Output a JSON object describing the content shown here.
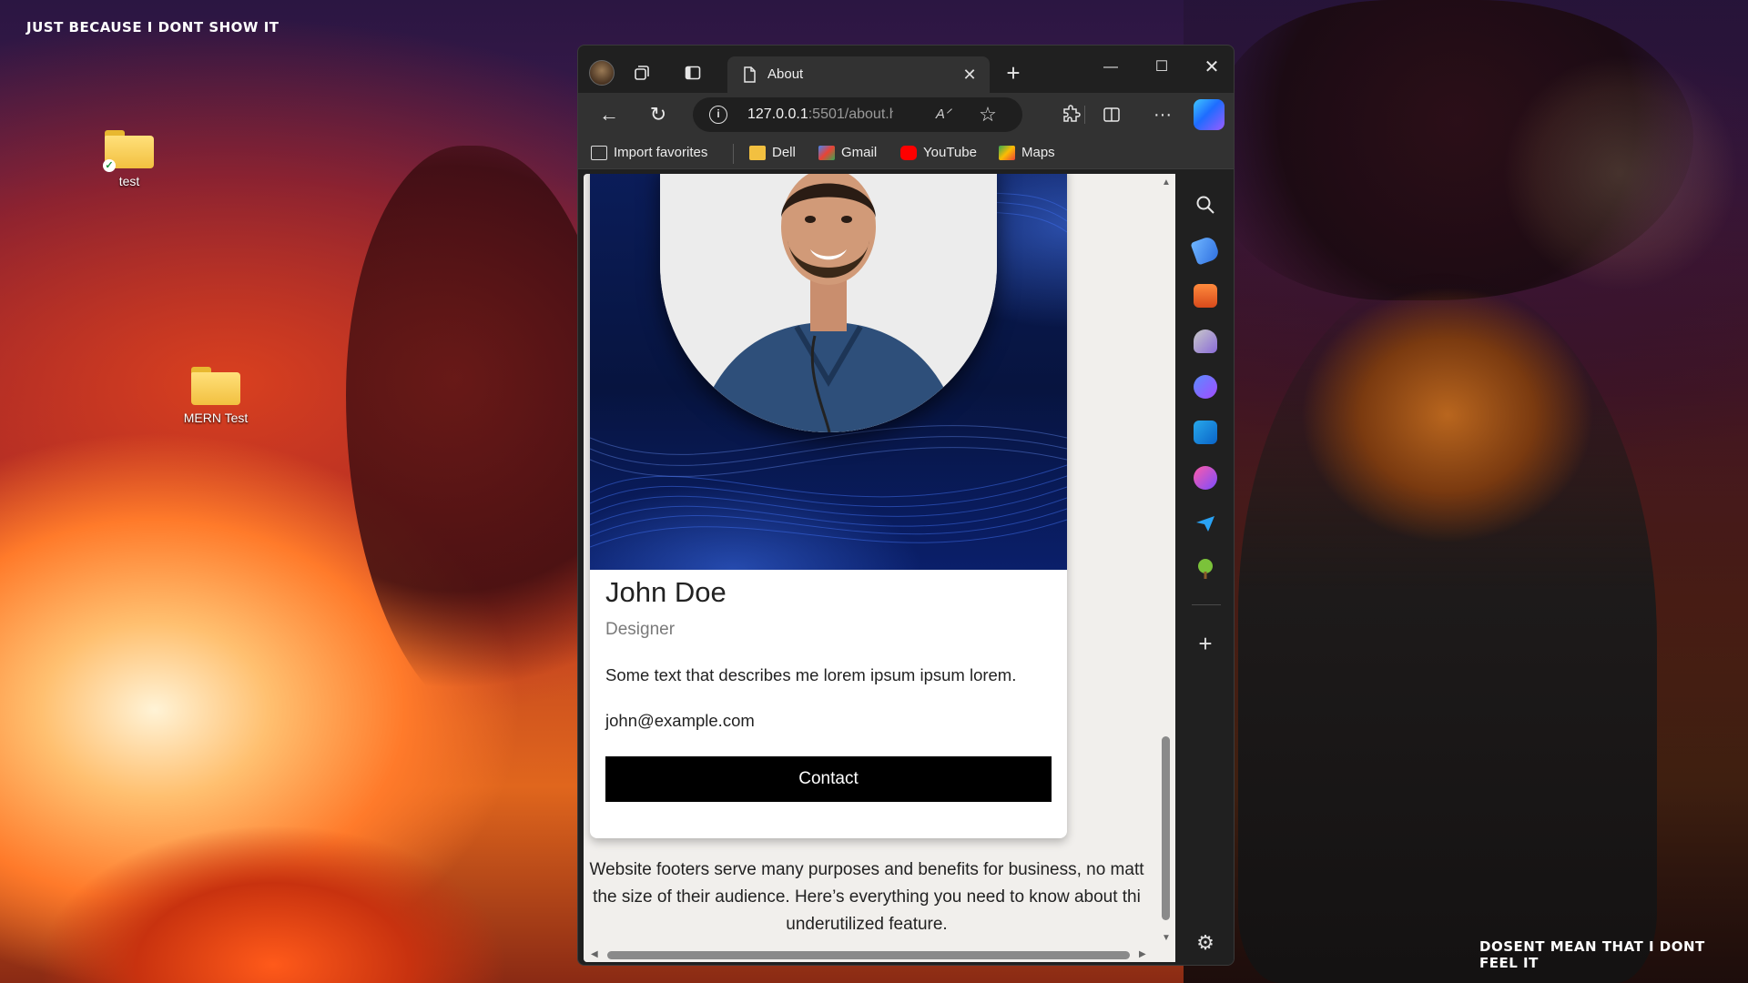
{
  "wallpaper": {
    "top_text": "JUST BECAUSE I DONT SHOW IT",
    "bottom_text": "DOSENT MEAN THAT I DONT FEEL IT"
  },
  "desktop": {
    "icons": [
      {
        "label": "test",
        "icon": "folder-icon",
        "synced": true
      },
      {
        "label": "MERN Test",
        "icon": "folder-icon",
        "synced": false
      }
    ]
  },
  "browser": {
    "tab": {
      "title": "About",
      "icon": "page-icon"
    },
    "address": {
      "host": "127.0.0.1",
      "rest": ":5501/about.ht..."
    },
    "bookmarks": [
      {
        "label": "Import favorites",
        "icon": "import-icon"
      },
      {
        "label": "Dell",
        "icon": "folder-icon"
      },
      {
        "label": "Gmail",
        "icon": "gmail-icon"
      },
      {
        "label": "YouTube",
        "icon": "youtube-icon"
      },
      {
        "label": "Maps",
        "icon": "maps-icon"
      }
    ],
    "colors": {
      "frame": "#202020",
      "toolbar": "#323232",
      "page_bg": "#f1efec",
      "button": "#000000"
    }
  },
  "page": {
    "card": {
      "name": "John Doe",
      "title": "Designer",
      "description": "Some text that describes me lorem ipsum ipsum lorem.",
      "email": "john@example.com",
      "contact_label": "Contact"
    },
    "footer_lines": [
      "Website footers serve many purposes and benefits for business, no matt",
      "the size of their audience. Here’s everything you need to know about thi",
      "underutilized feature."
    ]
  }
}
